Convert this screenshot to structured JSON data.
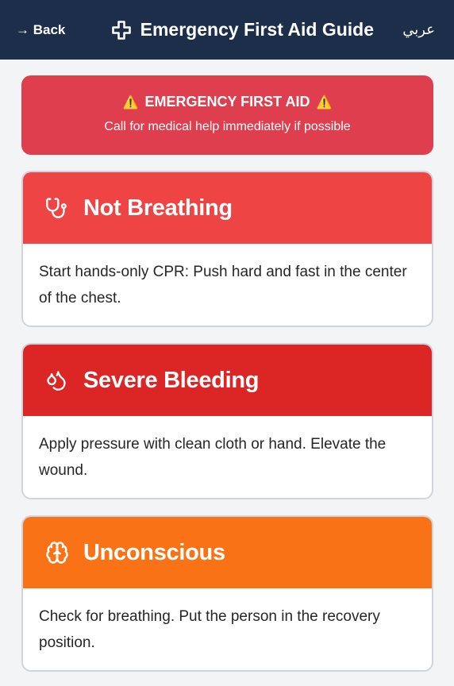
{
  "header": {
    "back_label": "→ Back",
    "title": "Emergency First Aid Guide",
    "language_label": "عربي",
    "icon": "medical-cross-icon"
  },
  "alert": {
    "title": "EMERGENCY FIRST AID",
    "subtitle": "Call for medical help immediately if possible",
    "warning_glyph": "⚠️"
  },
  "cards": [
    {
      "title": "Not Breathing",
      "icon": "stethoscope-icon",
      "color": "#ef4444",
      "instruction": "Start hands-only CPR: Push hard and fast in the center of the chest."
    },
    {
      "title": "Severe Bleeding",
      "icon": "droplets-icon",
      "color": "#dc2626",
      "instruction": "Apply pressure with clean cloth or hand. Elevate the wound."
    },
    {
      "title": "Unconscious",
      "icon": "brain-icon",
      "color": "#f97316",
      "instruction": "Check for breathing. Put the person in the recovery position."
    }
  ]
}
